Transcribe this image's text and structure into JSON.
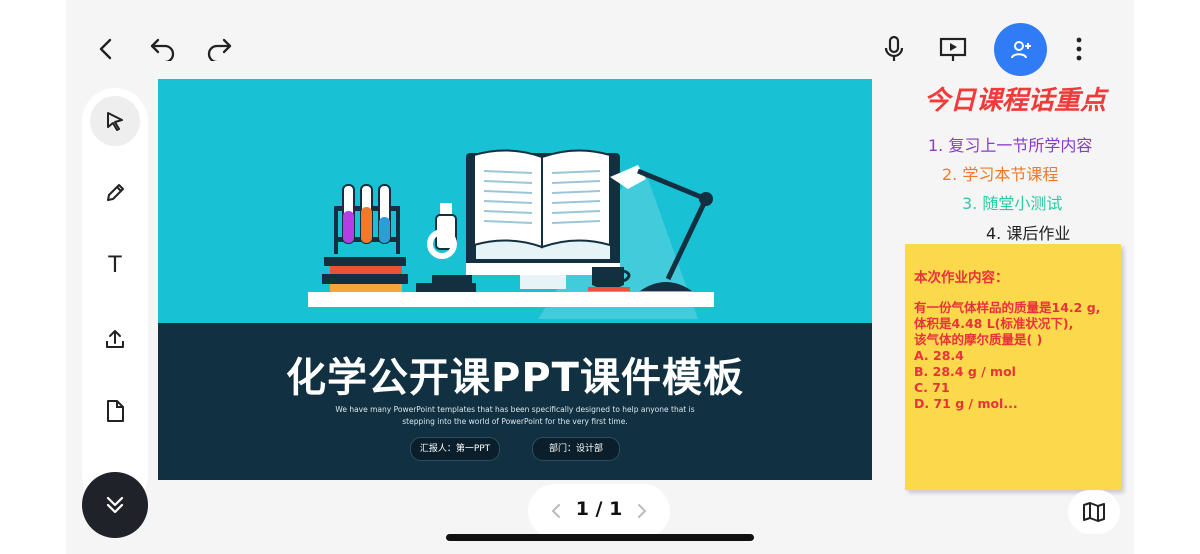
{
  "toolbar": {
    "back_icon": "chevron-left-icon",
    "undo_icon": "undo-icon",
    "redo_icon": "redo-icon",
    "mic_icon": "microphone-icon",
    "present_icon": "presentation-icon",
    "add_user_icon": "add-user-icon",
    "more_icon": "more-vertical-icon",
    "accent": "#2f7cf6"
  },
  "tools": [
    {
      "name": "select-tool",
      "icon": "cursor-arrow-icon",
      "active": true
    },
    {
      "name": "pen-tool",
      "icon": "pencil-icon"
    },
    {
      "name": "text-tool",
      "icon": "text-icon",
      "glyph": "T"
    },
    {
      "name": "upload-tool",
      "icon": "upload-icon"
    },
    {
      "name": "file-tool",
      "icon": "file-icon"
    }
  ],
  "slide": {
    "title": "化学公开课PPT课件模板",
    "subtitle_line1": "We have many PowerPoint templates that has been specifically designed to help anyone that is",
    "subtitle_line2": "stepping into the world of PowerPoint for the very first time.",
    "reporter": "汇报人：第一PPT",
    "department": "部门：设计部",
    "colors": {
      "top": "#19c1d4",
      "bottom": "#113142"
    }
  },
  "notes": {
    "heading": "今日课程话重点",
    "items": [
      {
        "text": "1. 复习上一节所学内容",
        "color": "#8a3bc9"
      },
      {
        "text": "2. 学习本节课程",
        "color": "#f07a2a"
      },
      {
        "text": "3. 随堂小测试",
        "color": "#2fc9a6"
      },
      {
        "text": "4. 课后作业",
        "color": "#222222"
      }
    ]
  },
  "sticky": {
    "title": "本次作业内容：",
    "body": "有一份气体样品的质量是14.2 g,\n体积是4.48 L(标准状况下),\n该气体的摩尔质量是( )\nA.   28.4\nB.   28.4 g / mol\nC.   71\nD.   71 g / mol...",
    "color": "#fbd84c",
    "text_color": "#e8333a"
  },
  "pager": {
    "label": "1 / 1"
  },
  "map_icon": "map-icon"
}
